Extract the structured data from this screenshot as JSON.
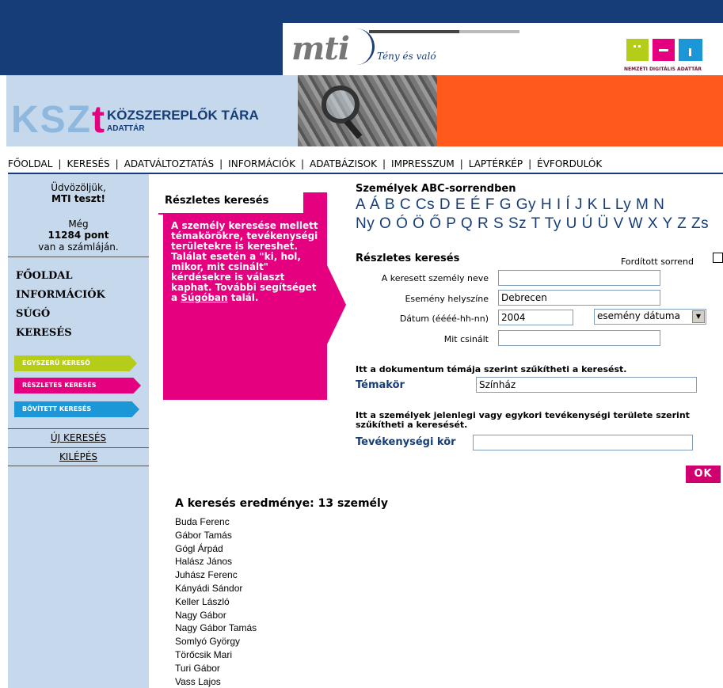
{
  "header": {
    "mti_logo": "mti",
    "mti_slogan": "Tény és való",
    "nda_text": "NEMZETI DIGITÁLIS ADATTÁR",
    "kszt_logo_a": "KSZ",
    "kszt_logo_b": "t",
    "kszt_title": "KÖZSZEREPLŐK TÁRA",
    "kszt_sub": "ADATTÁR",
    "colors": {
      "navy": "#163d78",
      "magenta": "#e4007e",
      "orange": "#ff5a1c",
      "lightblue": "#c6d8eb"
    }
  },
  "topnav": [
    "FŐOLDAL",
    "KERESÉS",
    "ADATVÁLTOZTATÁS",
    "INFORMÁCIÓK",
    "ADATBÁZISOK",
    "IMPRESSZUM",
    "LAPTÉRKÉP",
    "ÉVFORDULÓK"
  ],
  "sidebar": {
    "welcome": "Üdvözöljük,",
    "user": "MTI teszt!",
    "points_pre": "Még",
    "points": "11284 pont",
    "points_post": "van a számláján.",
    "links": [
      "FŐOLDAL",
      "INFORMÁCIÓK",
      "SÚGÓ",
      "KERESÉS"
    ],
    "buttons": [
      {
        "label": "EGYSZERŰ KERESŐ",
        "color": "#b5cc18"
      },
      {
        "label": "RÉSZLETES KERESÉS",
        "color": "#e4007e"
      },
      {
        "label": "BŐVÍTETT KERESÉS",
        "color": "#1b96d6"
      }
    ],
    "new_search": "ÚJ KERESÉS",
    "logout": "KILÉPÉS"
  },
  "help": {
    "title": "Részletes keresés",
    "text": "A személy keresése mellett témakörökre, tevékenységi területekre is kereshet. Találat esetén a \"ki, hol, mikor, mit csinált\" kérdésekre is választ kaphat. További segítséget a",
    "link": "Súgóban",
    "tail": "talál."
  },
  "abc": {
    "title": "Személyek ABC-sorrendben",
    "row1": [
      "A",
      "Á",
      "B",
      "C",
      "Cs",
      "D",
      "E",
      "É",
      "F",
      "G",
      "Gy",
      "H",
      "I",
      "Í",
      "J",
      "K",
      "L",
      "Ly",
      "M",
      "N"
    ],
    "row2": [
      "Ny",
      "O",
      "Ó",
      "Ö",
      "Ő",
      "P",
      "Q",
      "R",
      "S",
      "Sz",
      "T",
      "Ty",
      "U",
      "Ú",
      "Ü",
      "V",
      "W",
      "X",
      "Y",
      "Z",
      "Zs"
    ]
  },
  "form": {
    "title": "Részletes keresés",
    "reverse_label": "Fordított sorrend",
    "name_label": "A keresett személy neve",
    "name_value": "",
    "place_label": "Esemény helyszíne",
    "place_value": "Debrecen",
    "date_label": "Dátum (éééé-hh-nn)",
    "date_value": "2004",
    "date_select": "esemény dátuma",
    "what_label": "Mit csinált",
    "what_value": "",
    "topic_note": "Itt a dokumentum témája szerint szűkítheti a keresést.",
    "topic_label": "Témakör",
    "topic_value": "Színház",
    "activity_note": "Itt a személyek jelenlegi vagy egykori tevékenységi területe szerint szűkítheti a keresését.",
    "activity_label": "Tevékenységi kör",
    "activity_value": "",
    "ok": "OK"
  },
  "results": {
    "title": "A keresés eredménye: 13 személy",
    "items": [
      "Buda Ferenc",
      "Gábor Tamás",
      "Gógl Árpád",
      "Halász János",
      "Juhász Ferenc",
      "Kányádi Sándor",
      "Keller László",
      "Nagy Gábor",
      "Nagy Gábor Tamás",
      "Somlyó György",
      "Törőcsik Mari",
      "Turi Gábor",
      "Vass Lajos"
    ]
  }
}
